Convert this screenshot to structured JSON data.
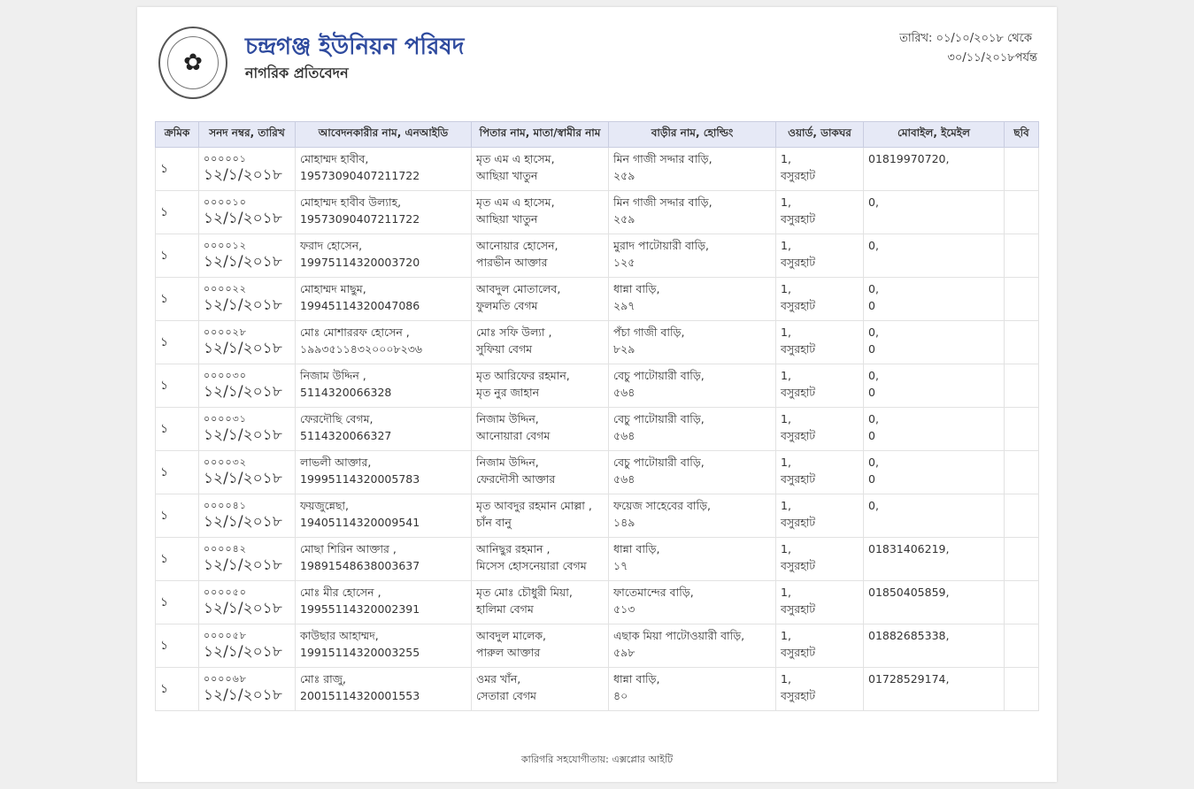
{
  "header": {
    "title": "চন্দ্রগঞ্জ ইউনিয়ন পরিষদ",
    "subtitle": "নাগরিক প্রতিবেদন",
    "date_from": "তারিখ: ০১/১০/২০১৮ থেকে",
    "date_to": "৩০/১১/২০১৮পর্যন্ত",
    "logo_icon": "government-seal-icon"
  },
  "columns": [
    "ক্রমিক",
    "সনদ নম্বর, তারিখ",
    "আবেদনকারীর নাম, এনআইডি",
    "পিতার নাম, মাতা/স্বামীর নাম",
    "বাড়ীর নাম, হোল্ডিং",
    "ওয়ার্ড, ডাকঘর",
    "মোবাইল, ইমেইল",
    "ছবি"
  ],
  "rows": [
    {
      "serial": "১",
      "sanad": "০০০০০১",
      "date": "১২/১/২০১৮",
      "name": "মোহাম্মদ হাবীব,",
      "nid": "19573090407211722",
      "father": "মৃত এম এ হাসেম,",
      "mother": "আছিয়া খাতুন",
      "house": "মিন গাজী সদ্দার বাড়ি,",
      "holding": "২৫৯",
      "ward": "1,",
      "post": "বসুরহাট",
      "mobile": "01819970720,",
      "email": ""
    },
    {
      "serial": "১",
      "sanad": "০০০০১০",
      "date": "১২/১/২০১৮",
      "name": "মোহাম্মদ হাবীব উল্যাহ,",
      "nid": "19573090407211722",
      "father": "মৃত এম এ হাসেম,",
      "mother": "আছিয়া খাতুন",
      "house": "মিন গাজী সদ্দার বাড়ি,",
      "holding": "২৫৯",
      "ward": "1,",
      "post": "বসুরহাট",
      "mobile": "0,",
      "email": ""
    },
    {
      "serial": "১",
      "sanad": "০০০০১২",
      "date": "১২/১/২০১৮",
      "name": "ফরাদ হোসেন,",
      "nid": "19975114320003720",
      "father": "আনোয়ার হোসেন,",
      "mother": "পারভীন আক্তার",
      "house": "মুরাদ পাটোয়ারী বাড়ি,",
      "holding": "১২৫",
      "ward": "1,",
      "post": "বসুরহাট",
      "mobile": "0,",
      "email": ""
    },
    {
      "serial": "১",
      "sanad": "০০০০২২",
      "date": "১২/১/২০১৮",
      "name": "মোহাম্মদ মাছুম,",
      "nid": "19945114320047086",
      "father": "আবদুল মোতালেব,",
      "mother": "ফুলমতি বেগম",
      "house": "ধান্না বাড়ি,",
      "holding": "২৯৭",
      "ward": "1,",
      "post": "বসুরহাট",
      "mobile": "0,",
      "email": "0"
    },
    {
      "serial": "১",
      "sanad": "০০০০২৮",
      "date": "১২/১/২০১৮",
      "name": "মোঃ মোশাররফ হোসেন ,",
      "nid": "১৯৯৩৫১১৪৩২০০০৮২৩৬",
      "father": "মোঃ সফি উল্যা ,",
      "mother": "সুফিয়া বেগম",
      "house": "পঁচা গাজী বাড়ি,",
      "holding": "৮২৯",
      "ward": "1,",
      "post": "বসুরহাট",
      "mobile": "0,",
      "email": "0"
    },
    {
      "serial": "১",
      "sanad": "০০০০৩০",
      "date": "১২/১/২০১৮",
      "name": "নিজাম উদ্দিন ,",
      "nid": "5114320066328",
      "father": "মৃত আরিফের রহমান,",
      "mother": "মৃত নুর জাহান",
      "house": "বেচু পাটোয়ারী বাড়ি,",
      "holding": "৫৬৪",
      "ward": "1,",
      "post": "বসুরহাট",
      "mobile": "0,",
      "email": "0"
    },
    {
      "serial": "১",
      "sanad": "০০০০৩১",
      "date": "১২/১/২০১৮",
      "name": "ফেরদৌছি বেগম,",
      "nid": "5114320066327",
      "father": "নিজাম উদ্দিন,",
      "mother": "আনোয়ারা বেগম",
      "house": "বেচু পাটোয়ারী বাড়ি,",
      "holding": "৫৬৪",
      "ward": "1,",
      "post": "বসুরহাট",
      "mobile": "0,",
      "email": "0"
    },
    {
      "serial": "১",
      "sanad": "০০০০৩২",
      "date": "১২/১/২০১৮",
      "name": "লাভলী আক্তার,",
      "nid": "19995114320005783",
      "father": "নিজাম উদ্দিন,",
      "mother": "ফেরদৌসী আক্তার",
      "house": "বেচু পাটোয়ারী বাড়ি,",
      "holding": "৫৬৪",
      "ward": "1,",
      "post": "বসুরহাট",
      "mobile": "0,",
      "email": "0"
    },
    {
      "serial": "১",
      "sanad": "০০০০৪১",
      "date": "১২/১/২০১৮",
      "name": "ফয়জুন্নেছা,",
      "nid": "19405114320009541",
      "father": "মৃত আবদুর রহমান মোল্লা ,",
      "mother": "চাঁন বানু",
      "house": "ফয়েজ সাহেবের বাড়ি,",
      "holding": "১৪৯",
      "ward": "1,",
      "post": "বসুরহাট",
      "mobile": "0,",
      "email": ""
    },
    {
      "serial": "১",
      "sanad": "০০০০৪২",
      "date": "১২/১/২০১৮",
      "name": "মোছা শিরিন আক্তার ,",
      "nid": "19891548638003637",
      "father": "আনিছুর রহমান ,",
      "mother": "মিসেস হোসনেয়ারা বেগম",
      "house": "ধান্না বাড়ি,",
      "holding": "১৭",
      "ward": "1,",
      "post": "বসুরহাট",
      "mobile": "01831406219,",
      "email": ""
    },
    {
      "serial": "১",
      "sanad": "০০০০৫০",
      "date": "১২/১/২০১৮",
      "name": "মোঃ মীর হোসেন ,",
      "nid": "19955114320002391",
      "father": "মৃত মোঃ চৌধুরী মিয়া,",
      "mother": "হালিমা বেগম",
      "house": "ফাতেমান্দের বাড়ি,",
      "holding": "৫১৩",
      "ward": "1,",
      "post": "বসুরহাট",
      "mobile": "01850405859,",
      "email": ""
    },
    {
      "serial": "১",
      "sanad": "০০০০৫৮",
      "date": "১২/১/২০১৮",
      "name": "কাউছার আহাম্মদ,",
      "nid": "19915114320003255",
      "father": "আবদুল মালেক,",
      "mother": "পারুল আক্তার",
      "house": "এছাক মিয়া পাটোওয়ারী বাড়ি,",
      "holding": "৫৯৮",
      "ward": "1,",
      "post": "বসুরহাট",
      "mobile": "01882685338,",
      "email": ""
    },
    {
      "serial": "১",
      "sanad": "০০০০৬৮",
      "date": "১২/১/২০১৮",
      "name": "মোঃ রাজু,",
      "nid": "20015114320001553",
      "father": "ওমর খাঁন,",
      "mother": "সেতারা বেগম",
      "house": "ধান্না বাড়ি,",
      "holding": "৪০",
      "ward": "1,",
      "post": "বসুরহাট",
      "mobile": "01728529174,",
      "email": ""
    }
  ],
  "footer": "কারিগরি সহযোগীতায়: এক্সপ্লোর আইটি"
}
